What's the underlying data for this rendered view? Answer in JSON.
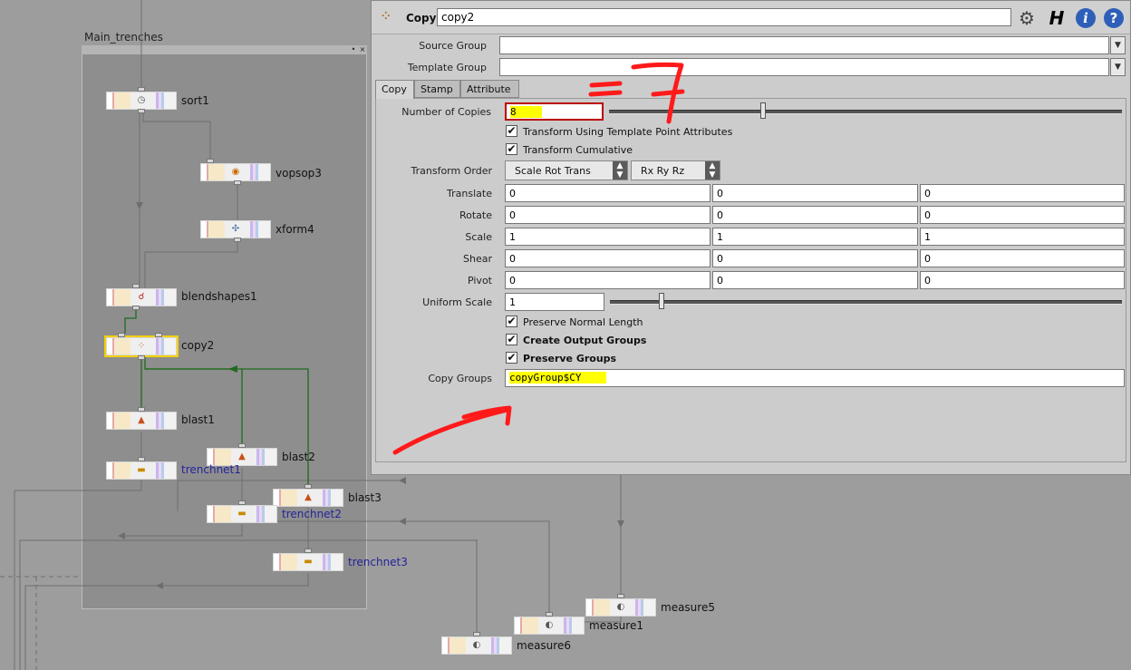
{
  "network": {
    "netbox_title": "Main_trenches",
    "netbox_btn_pin": "•",
    "netbox_btn_close": "×",
    "nodes": [
      {
        "label": "sort1",
        "icon": "sort-icon",
        "glyph": "◷"
      },
      {
        "label": "vopsop3",
        "icon": "vop-icon",
        "glyph": "◉"
      },
      {
        "label": "xform4",
        "icon": "transform-icon",
        "glyph": "✣"
      },
      {
        "label": "blendshapes1",
        "icon": "blendshapes-icon",
        "glyph": "☌"
      },
      {
        "label": "copy2",
        "icon": "copy-icon",
        "glyph": "⁘"
      },
      {
        "label": "blast1",
        "icon": "blast-icon",
        "glyph": "▲"
      },
      {
        "label": "blast2",
        "icon": "blast-icon",
        "glyph": "▲"
      },
      {
        "label": "blast3",
        "icon": "blast-icon",
        "glyph": "▲"
      },
      {
        "label": "trenchnet1",
        "icon": "subnet-icon",
        "glyph": "▬"
      },
      {
        "label": "trenchnet2",
        "icon": "subnet-icon",
        "glyph": "▬"
      },
      {
        "label": "trenchnet3",
        "icon": "subnet-icon",
        "glyph": "▬"
      },
      {
        "label": "measure5",
        "icon": "measure-icon",
        "glyph": "◐"
      },
      {
        "label": "measure1",
        "icon": "measure-icon",
        "glyph": "◐"
      },
      {
        "label": "measure6",
        "icon": "measure-icon",
        "glyph": "◐"
      }
    ]
  },
  "panel": {
    "op_type": "Copy",
    "node_name": "copy2",
    "icons": {
      "op": "copy-sop-icon",
      "gear": "gear-icon",
      "houdini": "houdini-h-icon",
      "info": "info-icon",
      "help": "help-icon"
    },
    "gear_glyph": "⚙",
    "houdini_glyph": "H",
    "info_glyph": "i",
    "help_glyph": "?",
    "op_glyph": "⁘",
    "source_group_label": "Source Group",
    "source_group_value": "",
    "template_group_label": "Template Group",
    "template_group_value": "",
    "dropdown_glyph": "▼",
    "tabs": [
      "Copy",
      "Stamp",
      "Attribute"
    ],
    "active_tab": "Copy",
    "num_copies_label": "Number of Copies",
    "num_copies_value": "8",
    "num_copies_slider": 0.3,
    "transform_template_label": "Transform Using Template Point Attributes",
    "transform_template_checked": true,
    "transform_cumulative_label": "Transform Cumulative",
    "transform_cumulative_checked": true,
    "transform_order_label": "Transform Order",
    "transform_order_value": "Scale Rot Trans",
    "rotate_order_value": "Rx Ry Rz",
    "vectors": [
      {
        "label": "Translate",
        "values": [
          "0",
          "0",
          "0"
        ]
      },
      {
        "label": "Rotate",
        "values": [
          "0",
          "0",
          "0"
        ]
      },
      {
        "label": "Scale",
        "values": [
          "1",
          "1",
          "1"
        ]
      },
      {
        "label": "Shear",
        "values": [
          "0",
          "0",
          "0"
        ]
      },
      {
        "label": "Pivot",
        "values": [
          "0",
          "0",
          "0"
        ]
      }
    ],
    "uniform_scale_label": "Uniform Scale",
    "uniform_scale_value": "1",
    "uniform_scale_slider": 0.1,
    "preserve_normal_label": "Preserve Normal Length",
    "preserve_normal_checked": true,
    "create_output_groups_label": "Create Output Groups",
    "create_output_groups_checked": true,
    "preserve_groups_label": "Preserve Groups",
    "preserve_groups_checked": true,
    "copy_groups_label": "Copy Groups",
    "copy_groups_value": "copyGroup$CY",
    "check_glyph": "✔"
  },
  "annotation": {
    "text": "=7",
    "color": "#ff1a1a"
  }
}
